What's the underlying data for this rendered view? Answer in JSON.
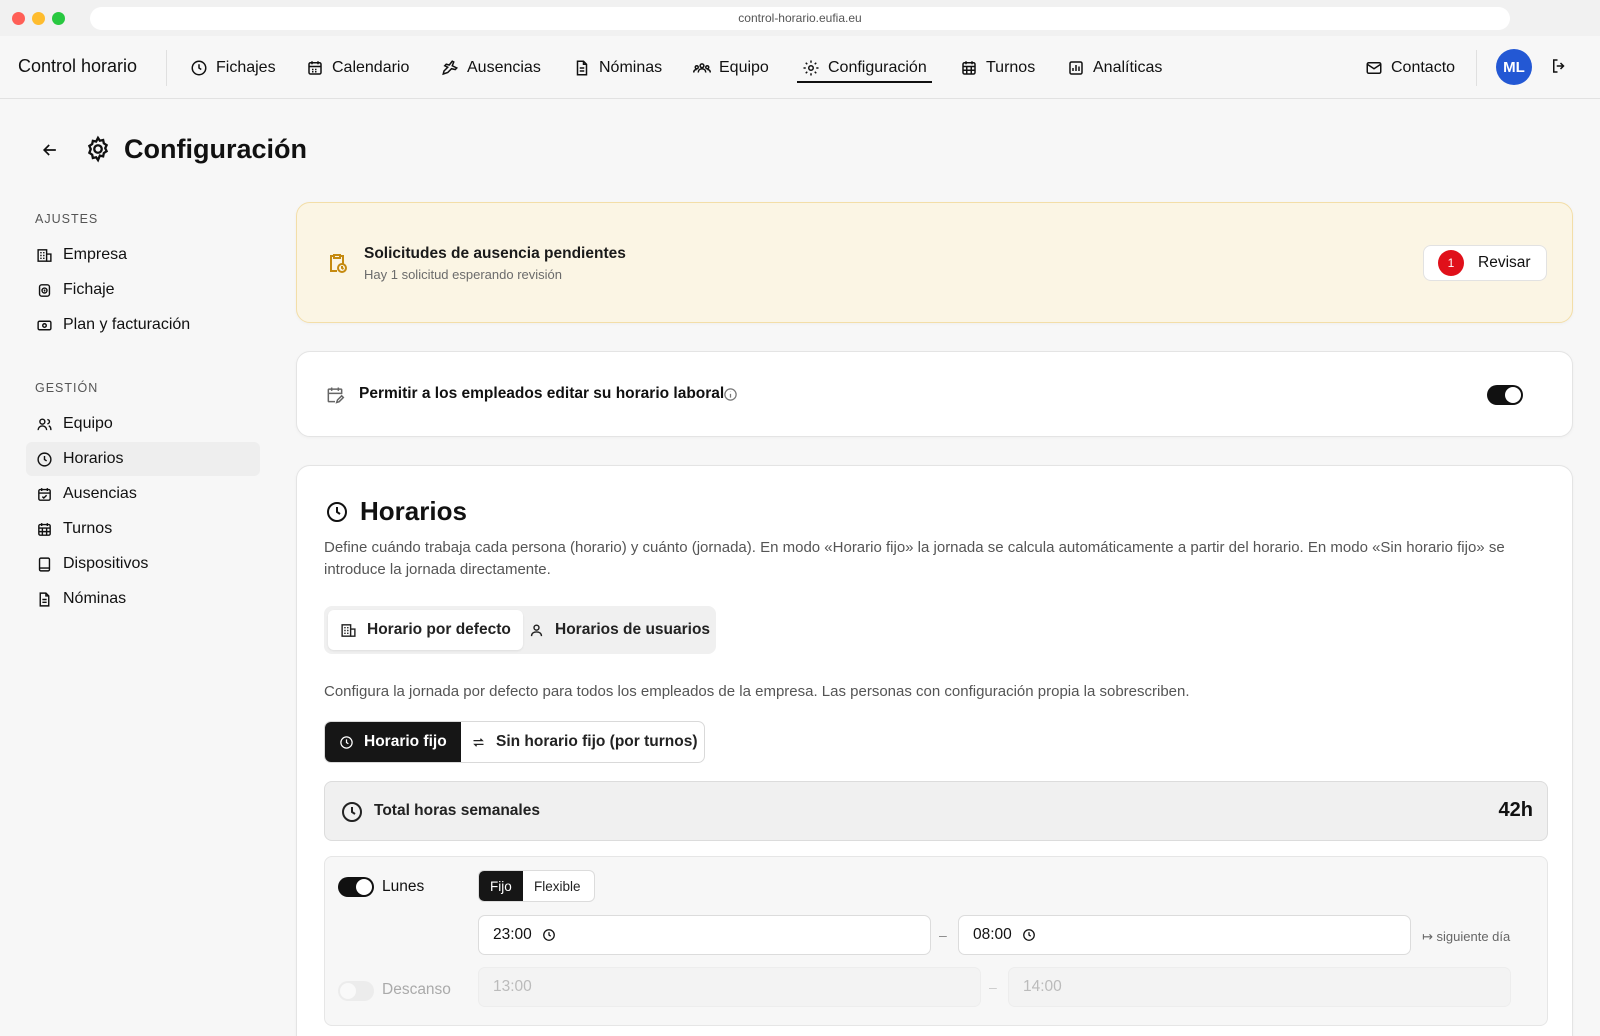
{
  "browser": {
    "url": "control-horario.eufia.eu"
  },
  "app": {
    "brand": "Control horario"
  },
  "nav": {
    "items": [
      {
        "label": "Fichajes",
        "icon": "clock-icon"
      },
      {
        "label": "Calendario",
        "icon": "calendar-icon"
      },
      {
        "label": "Ausencias",
        "icon": "plane-icon"
      },
      {
        "label": "Nóminas",
        "icon": "document-icon"
      },
      {
        "label": "Equipo",
        "icon": "team-icon"
      },
      {
        "label": "Configuración",
        "icon": "gear-icon",
        "active": true
      },
      {
        "label": "Turnos",
        "icon": "calendar-grid-icon"
      },
      {
        "label": "Analíticas",
        "icon": "chart-icon"
      }
    ],
    "contact": "Contacto",
    "avatar_initials": "ML"
  },
  "page": {
    "title": "Configuración"
  },
  "sidebar": {
    "section_ajustes": "AJUSTES",
    "ajustes": [
      {
        "label": "Empresa",
        "icon": "building-icon"
      },
      {
        "label": "Fichaje",
        "icon": "watch-icon"
      },
      {
        "label": "Plan y facturación",
        "icon": "billing-icon"
      }
    ],
    "section_gestion": "GESTIÓN",
    "gestion": [
      {
        "label": "Equipo",
        "icon": "users-icon"
      },
      {
        "label": "Horarios",
        "icon": "clock-icon",
        "active": true
      },
      {
        "label": "Ausencias",
        "icon": "calendar-check-icon"
      },
      {
        "label": "Turnos",
        "icon": "calendar-grid-icon"
      },
      {
        "label": "Dispositivos",
        "icon": "tablet-icon"
      },
      {
        "label": "Nóminas",
        "icon": "document-icon"
      }
    ]
  },
  "alert": {
    "title": "Solicitudes de ausencia pendientes",
    "subtitle": "Hay 1 solicitud esperando revisión",
    "badge": "1",
    "button": "Revisar"
  },
  "permission": {
    "label": "Permitir a los empleados editar su horario laboral",
    "enabled": true
  },
  "horarios": {
    "title": "Horarios",
    "description": "Define cuándo trabaja cada persona (horario) y cuánto (jornada). En modo «Horario fijo» la jornada se calcula automáticamente a partir del horario. En modo «Sin horario fijo» se introduce la jornada directamente.",
    "tabs": [
      "Horario por defecto",
      "Horarios de usuarios"
    ],
    "config_text": "Configura la jornada por defecto para todos los empleados de la empresa. Las personas con configuración propia la sobrescriben.",
    "modes": [
      "Horario fijo",
      "Sin horario fijo (por turnos)"
    ],
    "total_label": "Total horas semanales",
    "total_value": "42h",
    "day": {
      "name": "Lunes",
      "enabled": true,
      "types": [
        "Fijo",
        "Flexible"
      ],
      "start": "23:00",
      "end": "08:00",
      "separator": "–",
      "next_day": "↦ siguiente día",
      "break_label": "Descanso",
      "break_enabled": false,
      "break_start": "13:00",
      "break_end": "14:00"
    }
  },
  "colors": {
    "accent": "#161616",
    "avatar": "#2358d4",
    "alert_bg": "#fbf5e4",
    "badge": "#e0101a"
  }
}
